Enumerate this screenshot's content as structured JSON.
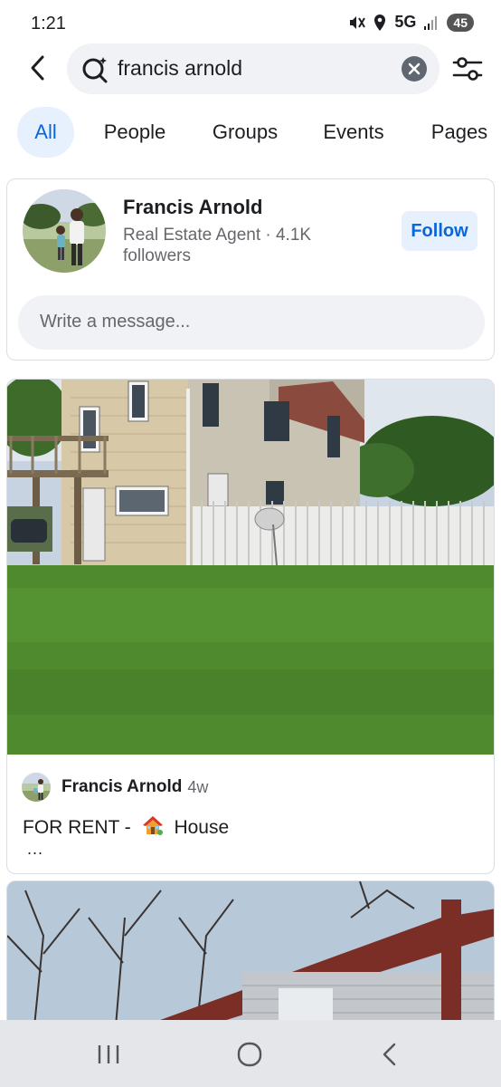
{
  "status_bar": {
    "time": "1:21",
    "network": "5G",
    "battery": "45",
    "icons": [
      "mute-icon",
      "location-icon",
      "signal-icon"
    ]
  },
  "search": {
    "query": "francis arnold",
    "back_icon": "back-arrow-icon",
    "search_icon": "search-icon",
    "clear_icon": "clear-icon",
    "filter_icon": "filter-sliders-icon"
  },
  "tabs": [
    {
      "label": "All",
      "selected": true
    },
    {
      "label": "People",
      "selected": false
    },
    {
      "label": "Groups",
      "selected": false
    },
    {
      "label": "Events",
      "selected": false
    },
    {
      "label": "Pages",
      "selected": false
    }
  ],
  "profile": {
    "name": "Francis Arnold",
    "subtitle": "Real Estate Agent · 4.1K followers",
    "follow_label": "Follow",
    "message_placeholder": "Write a message..."
  },
  "post": {
    "author": "Francis Arnold",
    "time": "4w",
    "text_before": "FOR RENT - ",
    "emoji": "🏠",
    "text_after": " House",
    "more": "..."
  },
  "nav": {
    "icons": [
      "recent-apps-icon",
      "home-icon",
      "back-icon"
    ]
  },
  "colors": {
    "accent": "#0a66d8",
    "accent_bg": "#e7f0fd",
    "input_bg": "#f0f2f5",
    "nav_bg": "#e4e6ea"
  }
}
